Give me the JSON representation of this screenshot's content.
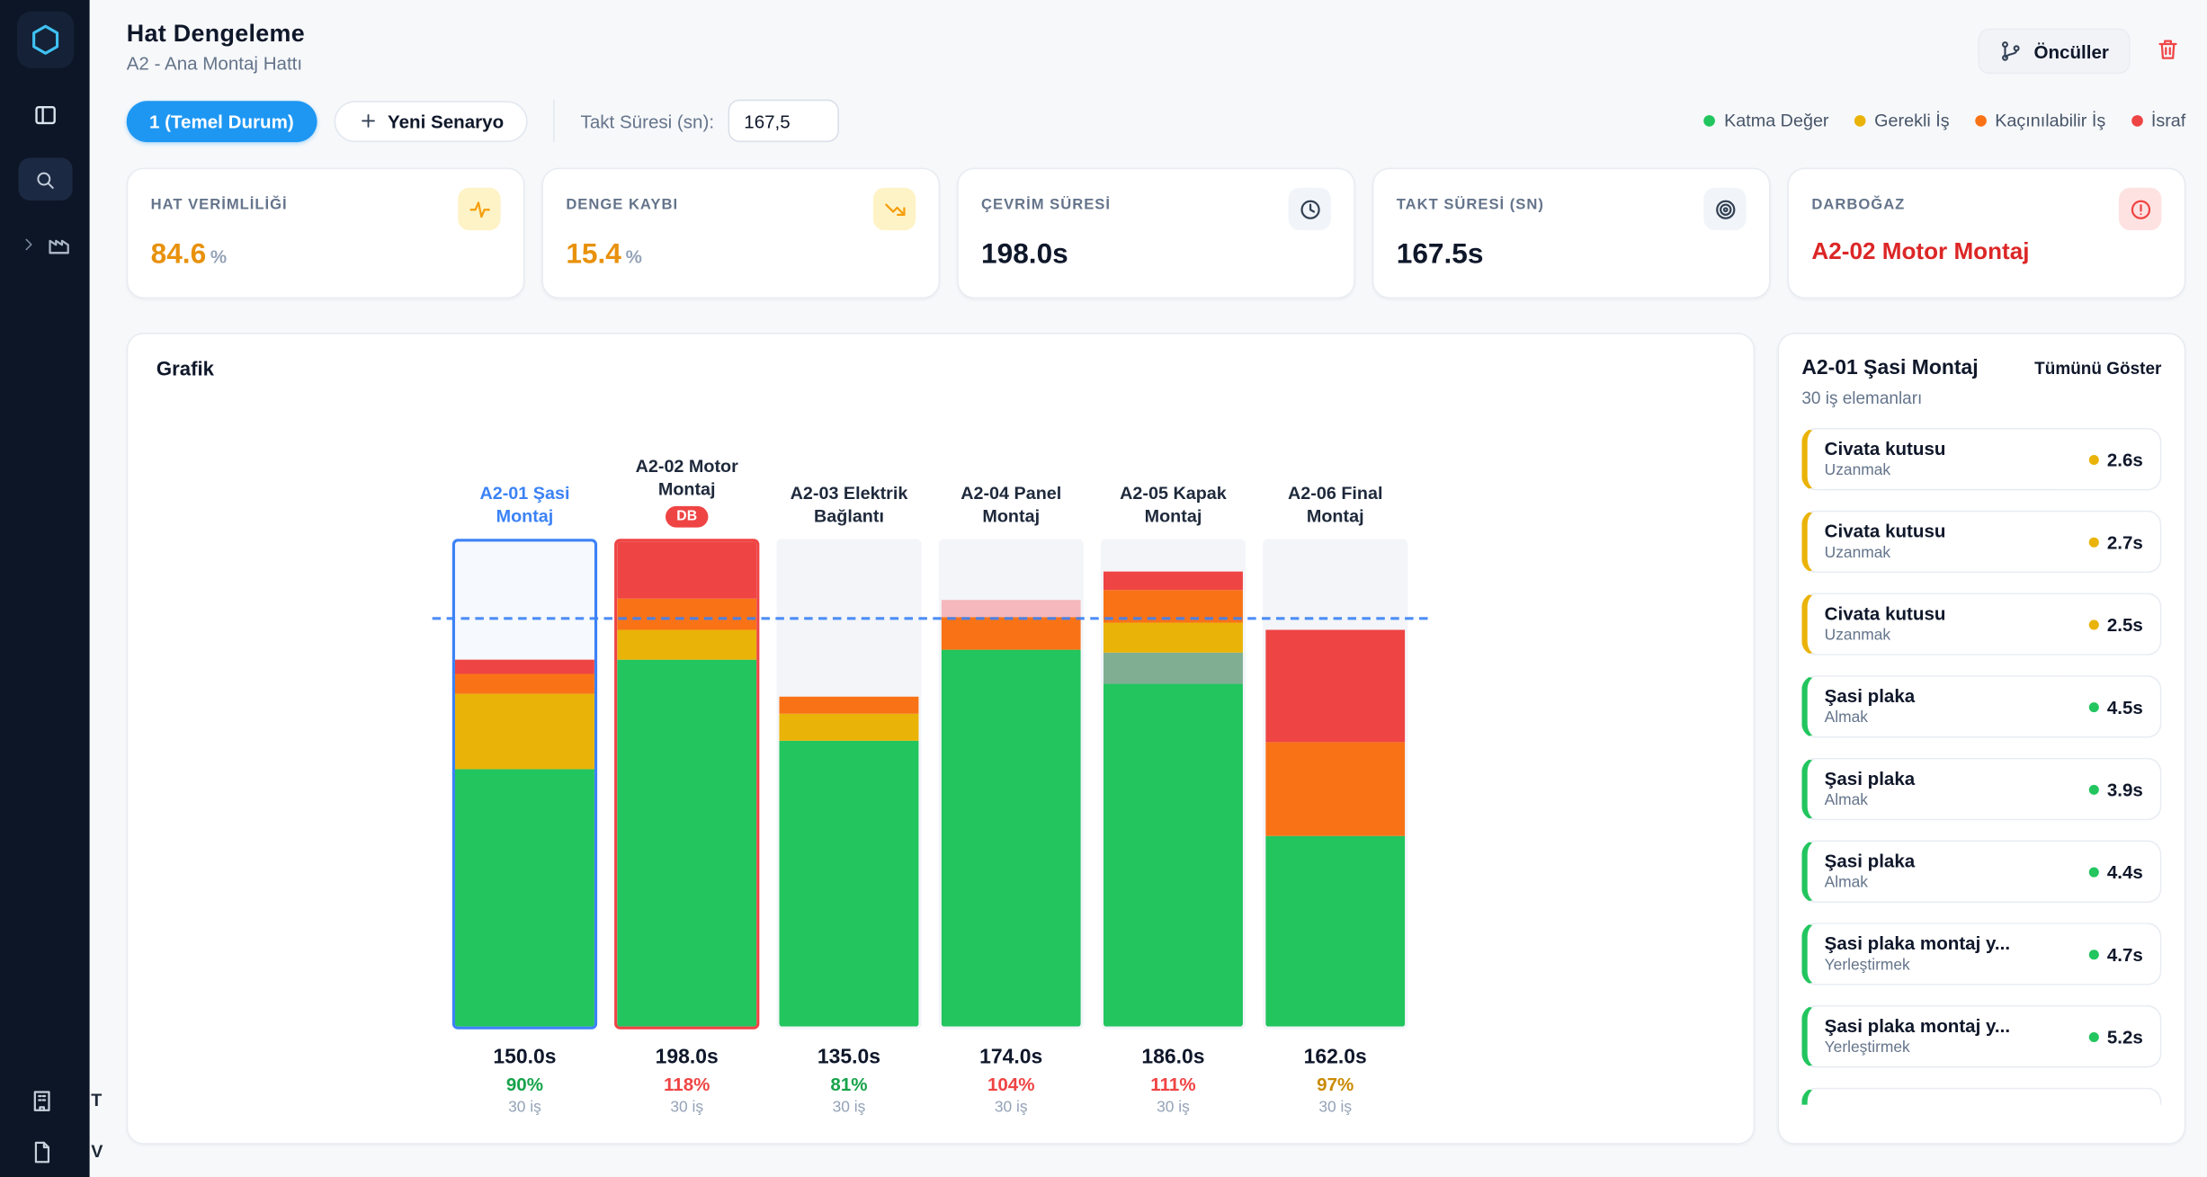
{
  "header": {
    "title": "Hat Dengeleme",
    "subtitle": "A2 - Ana Montaj Hattı",
    "predecessors_button": "Öncüller"
  },
  "toolbar": {
    "active_scenario": "1 (Temel Durum)",
    "new_scenario": "Yeni Senaryo",
    "takt_label": "Takt Süresi (sn):",
    "takt_value": "167,5"
  },
  "legend": {
    "items": [
      {
        "label": "Katma Değer",
        "color": "#22c55e"
      },
      {
        "label": "Gerekli İş",
        "color": "#eab308"
      },
      {
        "label": "Kaçınılabilir İş",
        "color": "#f97316"
      },
      {
        "label": "İsraf",
        "color": "#ef4444"
      }
    ]
  },
  "kpis": [
    {
      "label": "HAT VERİMLİLİĞİ",
      "value": "84.6",
      "suffix": "%",
      "icon": "activity-icon",
      "value_color": "#e8910c",
      "icon_color": "#f59e0b",
      "icon_bg": "#fef3c7"
    },
    {
      "label": "DENGE KAYBI",
      "value": "15.4",
      "suffix": "%",
      "icon": "trending-down-icon",
      "value_color": "#e8910c",
      "icon_color": "#f59e0b",
      "icon_bg": "#fef3c7"
    },
    {
      "label": "ÇEVRİM SÜRESİ",
      "value": "198.0s",
      "suffix": "",
      "icon": "clock-icon",
      "value_color": "#0f172a",
      "icon_color": "#334155",
      "icon_bg": "#f1f5f9"
    },
    {
      "label": "TAKT SÜRESİ (SN)",
      "value": "167.5s",
      "suffix": "",
      "icon": "target-icon",
      "value_color": "#0f172a",
      "icon_color": "#334155",
      "icon_bg": "#f1f5f9"
    },
    {
      "label": "DARBOĞAZ",
      "value": "A2-02 Motor Montaj",
      "suffix": "",
      "icon": "alert-circle-icon",
      "value_color": "#dc2626",
      "icon_color": "#ef4444",
      "icon_bg": "#fee2e2"
    }
  ],
  "chart_data": {
    "type": "bar",
    "title": "Grafik",
    "unit": "seconds",
    "y_max": 198,
    "takt_line_value": 167.5,
    "legend": [
      "Katma Değer",
      "Gerekli İş",
      "Kaçınılabilir İş",
      "İsraf"
    ],
    "categories": [
      "A2-01 Şasi Montaj",
      "A2-02 Motor Montaj",
      "A2-03 Elektrik Bağlantı",
      "A2-04 Panel Montaj",
      "A2-05 Kapak Montaj",
      "A2-06 Final Montaj"
    ],
    "stations": [
      {
        "name": "A2-01 Şasi Montaj",
        "selected": true,
        "bottleneck": false,
        "badge": "",
        "total": "150.0s",
        "total_seconds": 150,
        "percent": "90%",
        "percent_color": "#16a34a",
        "count": "30 iş",
        "segments": [
          {
            "seconds": 105,
            "color": "#22c55e"
          },
          {
            "seconds": 31,
            "color": "#eab308"
          },
          {
            "seconds": 8,
            "color": "#f97316"
          },
          {
            "seconds": 6,
            "color": "#ef4444"
          }
        ]
      },
      {
        "name": "A2-02 Motor Montaj",
        "selected": false,
        "bottleneck": true,
        "badge": "DB",
        "total": "198.0s",
        "total_seconds": 198,
        "percent": "118%",
        "percent_color": "#ef4444",
        "count": "30 iş",
        "segments": [
          {
            "seconds": 150,
            "color": "#22c55e"
          },
          {
            "seconds": 12,
            "color": "#eab308"
          },
          {
            "seconds": 13,
            "color": "#f97316"
          },
          {
            "seconds": 23,
            "color": "#ef4444"
          }
        ]
      },
      {
        "name": "A2-03 Elektrik Bağlantı",
        "selected": false,
        "bottleneck": false,
        "badge": "",
        "total": "135.0s",
        "total_seconds": 135,
        "percent": "81%",
        "percent_color": "#16a34a",
        "count": "30 iş",
        "segments": [
          {
            "seconds": 117,
            "color": "#22c55e"
          },
          {
            "seconds": 11,
            "color": "#eab308"
          },
          {
            "seconds": 7,
            "color": "#f97316"
          }
        ]
      },
      {
        "name": "A2-04 Panel Montaj",
        "selected": false,
        "bottleneck": false,
        "badge": "",
        "total": "174.0s",
        "total_seconds": 174,
        "percent": "104%",
        "percent_color": "#ef4444",
        "count": "30 iş",
        "segments": [
          {
            "seconds": 154,
            "color": "#22c55e"
          },
          {
            "seconds": 13,
            "color": "#f97316"
          },
          {
            "seconds": 7,
            "color": "#f5b8bd"
          }
        ]
      },
      {
        "name": "A2-05 Kapak Montaj",
        "selected": false,
        "bottleneck": false,
        "badge": "",
        "total": "186.0s",
        "total_seconds": 186,
        "percent": "111%",
        "percent_color": "#ef4444",
        "count": "30 iş",
        "segments": [
          {
            "seconds": 140,
            "color": "#22c55e"
          },
          {
            "seconds": 13,
            "color": "#7fae92"
          },
          {
            "seconds": 12,
            "color": "#eab308"
          },
          {
            "seconds": 13,
            "color": "#f97316"
          },
          {
            "seconds": 8,
            "color": "#ef4444"
          }
        ]
      },
      {
        "name": "A2-06 Final Montaj",
        "selected": false,
        "bottleneck": false,
        "badge": "",
        "total": "162.0s",
        "total_seconds": 162,
        "percent": "97%",
        "percent_color": "#ca8a04",
        "count": "30 iş",
        "segments": [
          {
            "seconds": 78,
            "color": "#22c55e"
          },
          {
            "seconds": 38,
            "color": "#f97316"
          },
          {
            "seconds": 46,
            "color": "#ef4444"
          }
        ]
      }
    ]
  },
  "detail_panel": {
    "title": "A2-01 Şasi Montaj",
    "show_all": "Tümünü Göster",
    "subtitle": "30 iş elemanları",
    "tasks": [
      {
        "title": "Civata kutusu",
        "subtitle": "Uzanmak",
        "time": "2.6s",
        "color": "#eab308"
      },
      {
        "title": "Civata kutusu",
        "subtitle": "Uzanmak",
        "time": "2.7s",
        "color": "#eab308"
      },
      {
        "title": "Civata kutusu",
        "subtitle": "Uzanmak",
        "time": "2.5s",
        "color": "#eab308"
      },
      {
        "title": "Şasi plaka",
        "subtitle": "Almak",
        "time": "4.5s",
        "color": "#22c55e"
      },
      {
        "title": "Şasi plaka",
        "subtitle": "Almak",
        "time": "3.9s",
        "color": "#22c55e"
      },
      {
        "title": "Şasi plaka",
        "subtitle": "Almak",
        "time": "4.4s",
        "color": "#22c55e"
      },
      {
        "title": "Şasi plaka montaj y...",
        "subtitle": "Yerleştirmek",
        "time": "4.7s",
        "color": "#22c55e"
      },
      {
        "title": "Şasi plaka montaj y...",
        "subtitle": "Yerleştirmek",
        "time": "5.2s",
        "color": "#22c55e"
      },
      {
        "title": "",
        "subtitle": "",
        "time": "",
        "color": "#22c55e"
      }
    ]
  },
  "sidebar": {
    "bottom_items": [
      {
        "icon": "building-icon",
        "label": "T"
      },
      {
        "icon": "file-icon",
        "label": "V"
      }
    ]
  }
}
